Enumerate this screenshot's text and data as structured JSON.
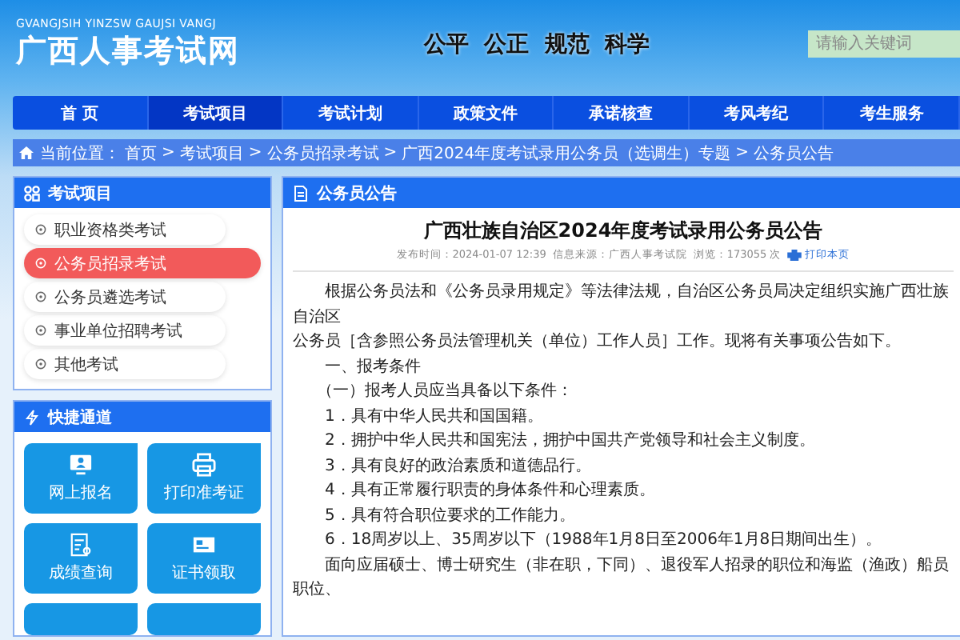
{
  "header": {
    "logo_pinyin": "GVANGJSIH YINZSW GAUJSI VANGJ",
    "logo_title": "广西人事考试网",
    "slogan": "公平  公正  规范  科学",
    "search": {
      "placeholder": "请输入关键词"
    }
  },
  "nav": [
    {
      "label": "首 页",
      "selected": false
    },
    {
      "label": "考试项目",
      "selected": true
    },
    {
      "label": "考试计划",
      "selected": false
    },
    {
      "label": "政策文件",
      "selected": false
    },
    {
      "label": "承诺核查",
      "selected": false
    },
    {
      "label": "考风考纪",
      "selected": false
    },
    {
      "label": "考生服务",
      "selected": false
    }
  ],
  "breadcrumb": {
    "label": "当前位置：",
    "separator": ">",
    "items": [
      "首页",
      "考试项目",
      "公务员招录考试",
      "广西2024年度考试录用公务员（选调生）专题",
      "公务员公告"
    ]
  },
  "sidebar": {
    "exam_panel": {
      "title": "考试项目",
      "items": [
        {
          "label": "职业资格类考试",
          "selected": false
        },
        {
          "label": "公务员招录考试",
          "selected": true
        },
        {
          "label": "公务员遴选考试",
          "selected": false
        },
        {
          "label": "事业单位招聘考试",
          "selected": false
        },
        {
          "label": "其他考试",
          "selected": false
        }
      ]
    },
    "quick_panel": {
      "title": "快捷通道",
      "links": [
        {
          "kind": "register",
          "label": "网上报名"
        },
        {
          "kind": "print",
          "label": "打印准考证"
        },
        {
          "kind": "score",
          "label": "成绩查询"
        },
        {
          "kind": "certificate",
          "label": "证书领取"
        },
        {
          "kind": "blank"
        },
        {
          "kind": "blank"
        }
      ]
    }
  },
  "article_panel": {
    "title": "公务员公告",
    "article": {
      "title": "广西壮族自治区2024年度考试录用公务员公告",
      "meta": [
        "发布时间：2024-01-07 12:39",
        "信息来源：广西人事考试院",
        "浏览：173055 次"
      ],
      "print_link": "打印本页",
      "paragraphs": [
        {
          "kind": "indent",
          "text": "根据公务员法和《公务员录用规定》等法律法规，自治区公务员局决定组织实施广西壮族自治区"
        },
        {
          "kind": "plain",
          "text": "公务员［含参照公务员法管理机关（单位）工作人员］工作。现将有关事项公告如下。"
        },
        {
          "kind": "indent",
          "text": "一、报考条件"
        },
        {
          "kind": "half",
          "text": "（一）报考人员应当具备以下条件："
        },
        {
          "kind": "indent",
          "text": "1．具有中华人民共和国国籍。"
        },
        {
          "kind": "indent",
          "text": "2．拥护中华人民共和国宪法，拥护中国共产党领导和社会主义制度。"
        },
        {
          "kind": "indent",
          "text": "3．具有良好的政治素质和道德品行。"
        },
        {
          "kind": "indent",
          "text": "4．具有正常履行职责的身体条件和心理素质。"
        },
        {
          "kind": "indent",
          "text": "5．具有符合职位要求的工作能力。"
        },
        {
          "kind": "indent",
          "text": "6．18周岁以上、35周岁以下（1988年1月8日至2006年1月8日期间出生）。"
        },
        {
          "kind": "indent",
          "text": "面向应届硕士、博士研究生（非在职，下同）、退役军人招录的职位和海监（渔政）船员职位、"
        }
      ]
    }
  }
}
